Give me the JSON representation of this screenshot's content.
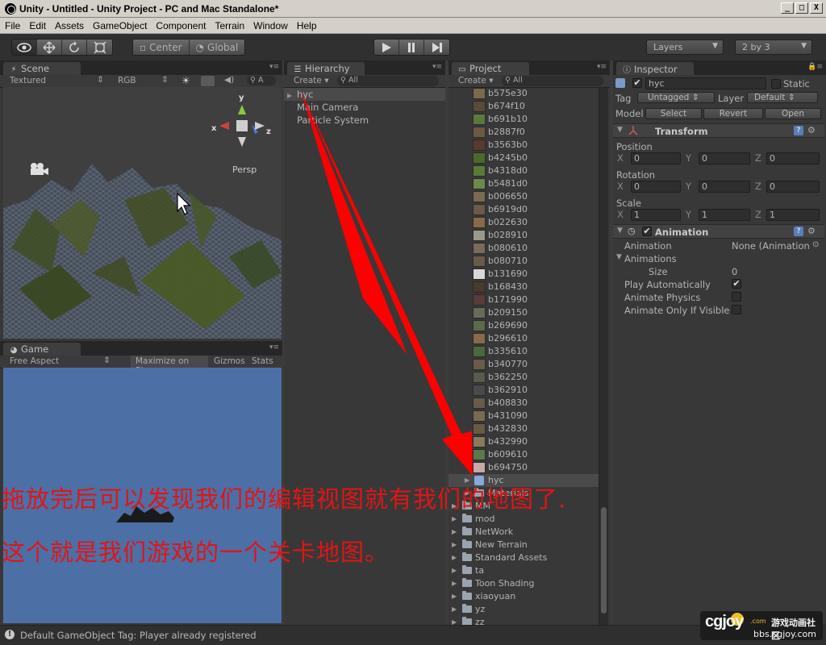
{
  "window": {
    "title": "Unity - Untitled - Unity Project - PC and Mac Standalone*",
    "buttons": [
      "_",
      "□",
      "X"
    ]
  },
  "menu": [
    "File",
    "Edit",
    "Assets",
    "GameObject",
    "Component",
    "Terrain",
    "Window",
    "Help"
  ],
  "toolbar": {
    "pivot": "Center",
    "space": "Global",
    "layers": "Layers",
    "layout": "2 by 3"
  },
  "scene": {
    "tab": "Scene",
    "render_mode": "Textured",
    "color_mode": "RGB",
    "search_placeholder": "A",
    "gizmo_label": "Persp",
    "axes": {
      "x": "x",
      "y": "y",
      "z": "z"
    }
  },
  "game": {
    "tab": "Game",
    "aspect": "Free Aspect",
    "maximize": "Maximize on Play",
    "gizmos": "Gizmos",
    "stats": "Stats"
  },
  "hierarchy": {
    "tab": "Hierarchy",
    "create": "Create",
    "search_placeholder": "All",
    "items": [
      "hyc",
      "Main Camera",
      "Particle System"
    ]
  },
  "project": {
    "tab": "Project",
    "create": "Create",
    "search_placeholder": "All",
    "textures": [
      {
        "name": "b575e30",
        "color": "#7a6a4a"
      },
      {
        "name": "b674f10",
        "color": "#5a4a3a"
      },
      {
        "name": "b691b10",
        "color": "#5a7a3a"
      },
      {
        "name": "b2887f0",
        "color": "#6a5a42"
      },
      {
        "name": "b3563b0",
        "color": "#5a3a2a"
      },
      {
        "name": "b4245b0",
        "color": "#4a6a2a"
      },
      {
        "name": "b4318d0",
        "color": "#5a7a3a"
      },
      {
        "name": "b5481d0",
        "color": "#6a8a4a"
      },
      {
        "name": "b006650",
        "color": "#7a6a52"
      },
      {
        "name": "b6919d0",
        "color": "#6a5a4a"
      },
      {
        "name": "b022630",
        "color": "#8a6a4a"
      },
      {
        "name": "b028910",
        "color": "#9a9a8a"
      },
      {
        "name": "b080610",
        "color": "#7a6a5a"
      },
      {
        "name": "b080710",
        "color": "#6a5a4a"
      },
      {
        "name": "b131690",
        "color": "#d8d8d8"
      },
      {
        "name": "b168430",
        "color": "#4a3a2a"
      },
      {
        "name": "b171990",
        "color": "#5a3a3a"
      },
      {
        "name": "b209150",
        "color": "#6a6a5a"
      },
      {
        "name": "b269690",
        "color": "#5a6a4a"
      },
      {
        "name": "b296610",
        "color": "#8a6a4a"
      },
      {
        "name": "b335610",
        "color": "#4a6a3a"
      },
      {
        "name": "b340770",
        "color": "#6a5a4a"
      },
      {
        "name": "b362250",
        "color": "#5a5a4a"
      },
      {
        "name": "b362910",
        "color": "#4a4a4a"
      },
      {
        "name": "b408830",
        "color": "#6a5a4a"
      },
      {
        "name": "b431090",
        "color": "#7a6a52"
      },
      {
        "name": "b432830",
        "color": "#6a5a42"
      },
      {
        "name": "b432990",
        "color": "#8a7a5a"
      },
      {
        "name": "b609610",
        "color": "#5a7a4a"
      },
      {
        "name": "b694750",
        "color": "#c8a8a8"
      }
    ],
    "selected": "hyc",
    "materials": "Materials",
    "folders": [
      "MM",
      "mod",
      "NetWork",
      "New Terrain",
      "Standard Assets",
      "ta",
      "Toon Shading",
      "xiaoyuan",
      "yz",
      "zz"
    ]
  },
  "inspector": {
    "tab": "Inspector",
    "object_name": "hyc",
    "static_label": "Static",
    "tag_label": "Tag",
    "tag_value": "Untagged",
    "layer_label": "Layer",
    "layer_value": "Default",
    "model_label": "Model",
    "select": "Select",
    "revert": "Revert",
    "open": "Open",
    "transform": {
      "title": "Transform",
      "position_label": "Position",
      "rotation_label": "Rotation",
      "scale_label": "Scale",
      "position": {
        "x": "0",
        "y": "0",
        "z": "0"
      },
      "rotation": {
        "x": "0",
        "y": "0",
        "z": "0"
      },
      "scale": {
        "x": "1",
        "y": "1",
        "z": "1"
      }
    },
    "animation": {
      "title": "Animation",
      "animation_label": "Animation",
      "animation_value": "None (Animation",
      "animations_label": "Animations",
      "size_label": "Size",
      "size_value": "0",
      "play_auto": "Play Automatically",
      "animate_physics": "Animate Physics",
      "animate_visible": "Animate Only If Visible"
    }
  },
  "status": "Default GameObject Tag: Player already registered",
  "caption": {
    "line1": "拖放完后可以发现我们的编辑视图就有我们的地图了.",
    "line2": "这个就是我们游戏的一个关卡地图。"
  },
  "watermark": {
    "brand": "cgjoy",
    "sub": ".com",
    "cn": "游戏动画社区",
    "url": "bbs.cgjoy.com"
  },
  "colors": {
    "annotation": "#e31414",
    "game_bg": "#4c6fa6",
    "panel": "#383838"
  }
}
